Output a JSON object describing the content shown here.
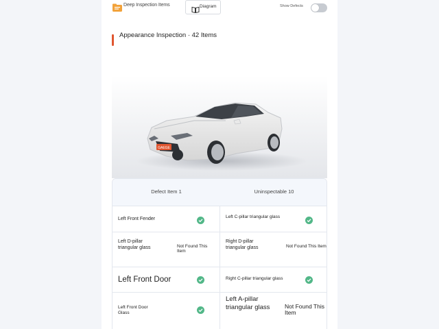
{
  "topbar": {
    "deep_inspection_label": "Deep Inspection Items",
    "diagram_label": "Diagram",
    "toggle_label": "Show Defects",
    "toggle_on": false,
    "accent_color": "#e0552f"
  },
  "section": {
    "title": "Appearance Inspection · 42 Items"
  },
  "car": {
    "plate_text": "GAEGE"
  },
  "table": {
    "headers": [
      "Defect Item 1",
      "Uninspectable 10"
    ],
    "rows": [
      {
        "left": {
          "name": "Left Front Fender",
          "status": "ok"
        },
        "right": {
          "name": "Left C-pillar triangular glass",
          "status": "ok"
        }
      },
      {
        "left": {
          "name": "Left D-pillar triangular glass",
          "status": "not_found",
          "status_text": "Not Found This Item"
        },
        "right": {
          "name": "Right D-pillar triangular glass",
          "status": "not_found",
          "status_text": "Not Found This Item"
        }
      },
      {
        "left": {
          "name": "Left Front Door",
          "status": "ok"
        },
        "right": {
          "name": "Right C-pillar triangular glass",
          "status": "ok"
        }
      },
      {
        "left": {
          "name": "Left Front Door Glass",
          "status": "ok"
        },
        "right": {
          "name": "Left A-pillar triangular glass",
          "status": "not_found",
          "status_text": "Not Found This Item"
        }
      }
    ],
    "ok_color": "#52b788"
  }
}
